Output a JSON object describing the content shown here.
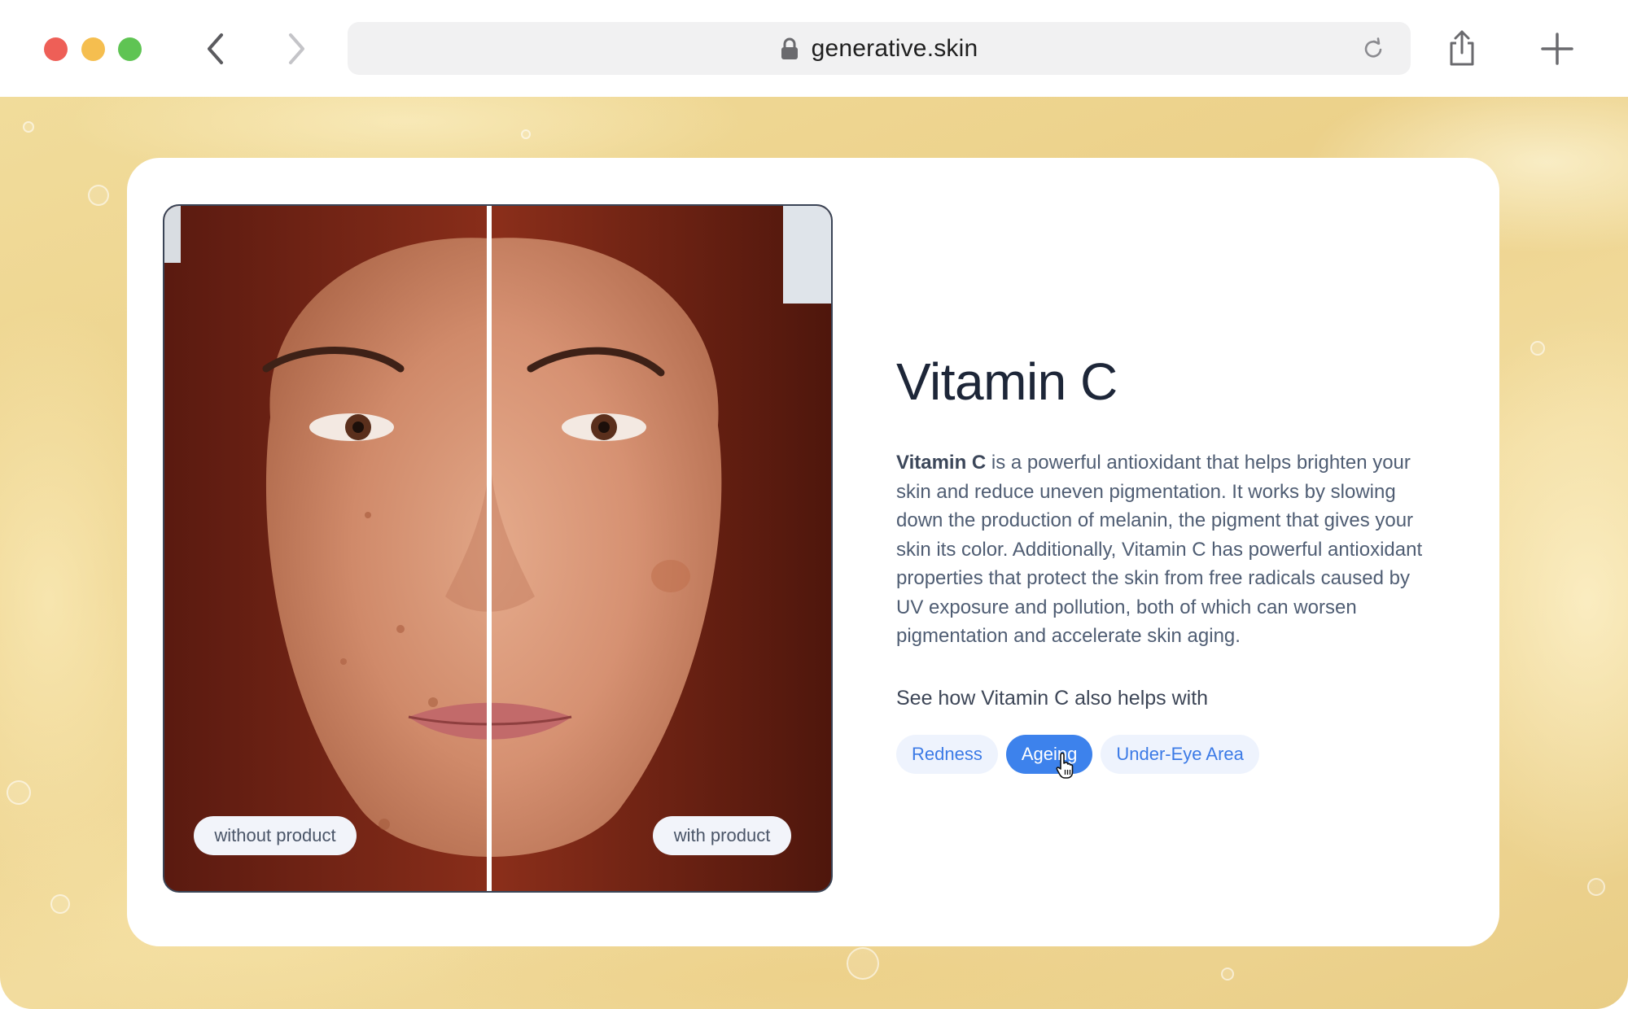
{
  "browser": {
    "url": "generative.skin",
    "icons": {
      "back": "chevron-left-icon",
      "forward": "chevron-right-icon",
      "lock": "lock-icon",
      "reload": "reload-icon",
      "share": "share-icon",
      "new_tab": "plus-icon"
    },
    "traffic_lights": {
      "close": "#ee5f57",
      "minimize": "#f5be4f",
      "zoom": "#5fc453"
    }
  },
  "comparison": {
    "left_label": "without product",
    "right_label": "with product"
  },
  "ingredient": {
    "title": "Vitamin C",
    "description_lead": "Vitamin C",
    "description_rest": " is a powerful antioxidant that helps brighten your skin and reduce uneven pigmentation. It works by slowing down the production of melanin, the pigment that gives your skin its color. Additionally, Vitamin C has powerful antioxidant properties that protect the skin from free radicals caused by UV exposure and pollution, both of which can worsen pigmentation and accelerate skin aging.",
    "helps_heading": "See how Vitamin C also helps with",
    "concerns": [
      {
        "label": "Redness",
        "selected": false
      },
      {
        "label": "Ageing",
        "selected": true
      },
      {
        "label": "Under-Eye Area",
        "selected": false
      }
    ]
  },
  "colors": {
    "accent": "#3d82ec",
    "chip_bg": "#eef3fd",
    "title": "#1d2638",
    "body_text": "#4f5d73"
  }
}
